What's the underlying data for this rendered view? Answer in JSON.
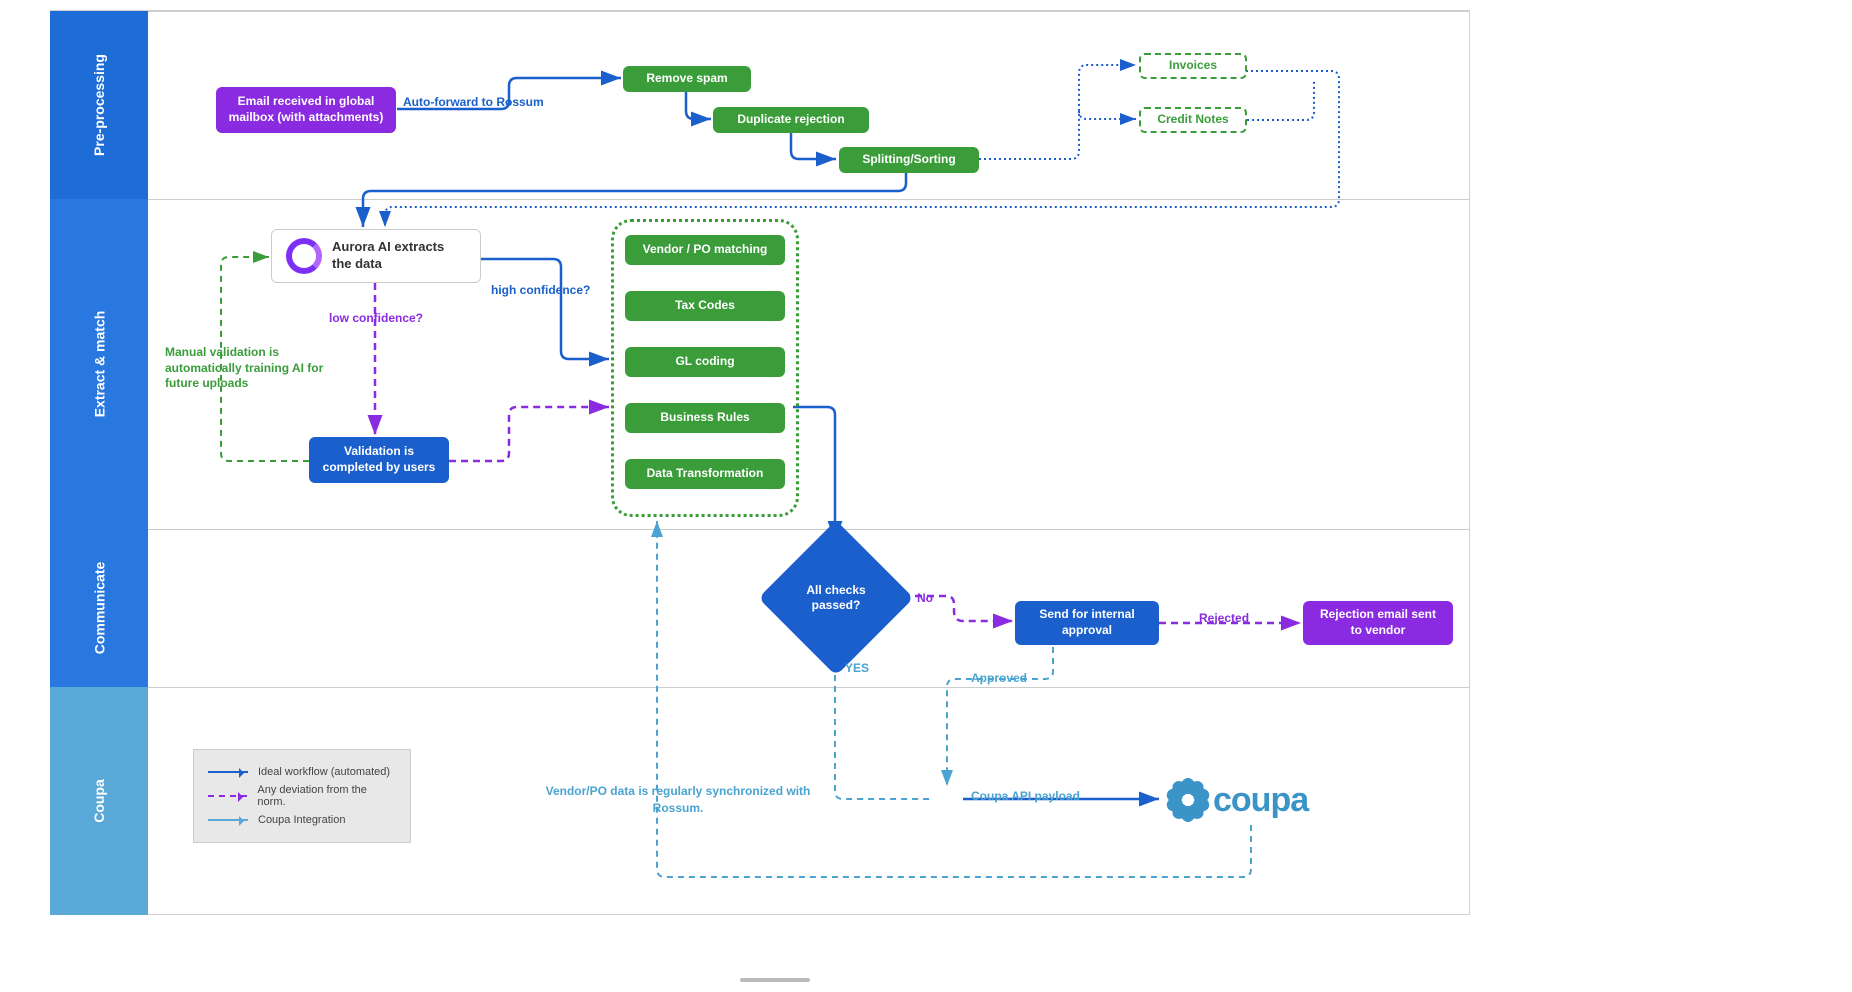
{
  "lanes": {
    "preprocessing": "Pre-processing",
    "extract": "Extract & match",
    "communicate": "Communicate",
    "coupa": "Coupa"
  },
  "nodes": {
    "email": "Email received in global mailbox (with attachments)",
    "removeSpam": "Remove spam",
    "dupReject": "Duplicate rejection",
    "splitSort": "Splitting/Sorting",
    "invoices": "Invoices",
    "creditNotes": "Credit Notes",
    "aurora": "Aurora AI extracts the data",
    "validation": "Validation is completed by users",
    "vendorPO": "Vendor / PO matching",
    "taxCodes": "Tax Codes",
    "glCoding": "GL coding",
    "bizRules": "Business Rules",
    "dataTransform": "Data Transformation",
    "allChecks": "All checks passed?",
    "sendApproval": "Send for internal approval",
    "rejectEmail": "Rejection email sent to vendor",
    "coupaLogo": "coupa"
  },
  "labels": {
    "autoForward": "Auto-forward to Rossum",
    "lowConf": "low confidence?",
    "highConf": "high confidence?",
    "manualTrain": "Manual validation is automatically training AI for future uploads",
    "no": "No",
    "yes": "YES",
    "approved": "Approved",
    "rejected": "Rejected",
    "apiPayload": "Coupa API payload",
    "syncNote": "Vendor/PO data is regularly synchronized with Rossum."
  },
  "legend": {
    "ideal": "Ideal workflow (automated)",
    "deviation": "Any deviation from the norm.",
    "coupa": "Coupa Integration"
  }
}
